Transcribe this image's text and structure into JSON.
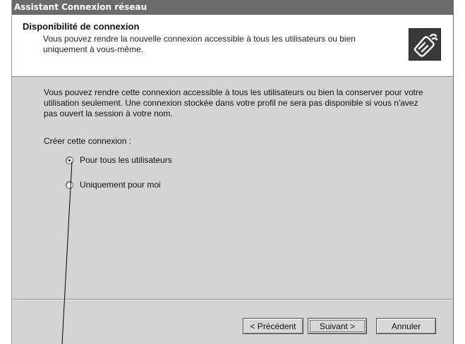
{
  "window": {
    "title": "Assistant Connexion réseau"
  },
  "header": {
    "title": "Disponibilité de connexion",
    "subtitle": "Vous pouvez rendre la nouvelle connexion accessible à tous les utilisateurs ou bien uniquement à vous-même.",
    "icon": "network-connection-wizard-icon"
  },
  "content": {
    "description": "Vous pouvez rendre cette connexion accessible à tous les utilisateurs ou bien la conserver pour votre utilisation seulement. Une connexion stockée dans votre profil ne sera pas disponible si vous n'avez pas ouvert la session à votre nom.",
    "group_label": "Créer cette connexion :",
    "options": [
      {
        "label": "Pour tous les utilisateurs",
        "selected": true
      },
      {
        "label": "Uniquement pour moi",
        "selected": false
      }
    ]
  },
  "buttons": {
    "back": "< Précédent",
    "next": "Suivant >",
    "cancel": "Annuler"
  }
}
